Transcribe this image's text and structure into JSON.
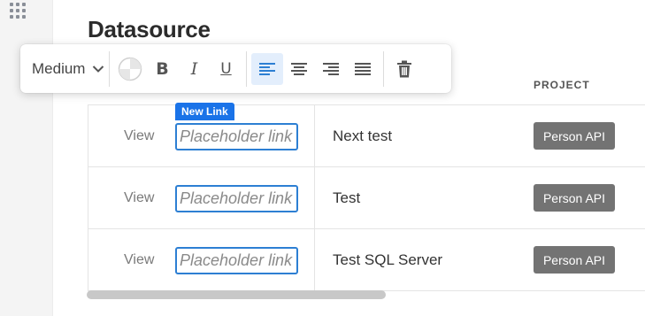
{
  "page": {
    "title": "Datasource"
  },
  "toolbar": {
    "size_value": "Medium",
    "buttons": [
      "color",
      "bold",
      "italic",
      "underline",
      "align-left",
      "align-center",
      "align-right",
      "align-justify",
      "delete"
    ],
    "active_button": "align-left",
    "bold_glyph": "B",
    "italic_glyph": "I",
    "underline_glyph": "U"
  },
  "table": {
    "columns": {
      "project": "PROJECT"
    },
    "new_link_tag": "New Link",
    "rows": [
      {
        "action": "View",
        "link_placeholder": "Placeholder link",
        "name": "Next test",
        "project": "Person API"
      },
      {
        "action": "View",
        "link_placeholder": "Placeholder link",
        "name": "Test",
        "project": "Person API"
      },
      {
        "action": "View",
        "link_placeholder": "Placeholder link",
        "name": "Test SQL Server",
        "project": "Person API"
      }
    ]
  },
  "colors": {
    "accent": "#1a73e8",
    "input_border": "#2d7fd3",
    "badge": "#737373",
    "active_bg": "#e3eefc"
  }
}
